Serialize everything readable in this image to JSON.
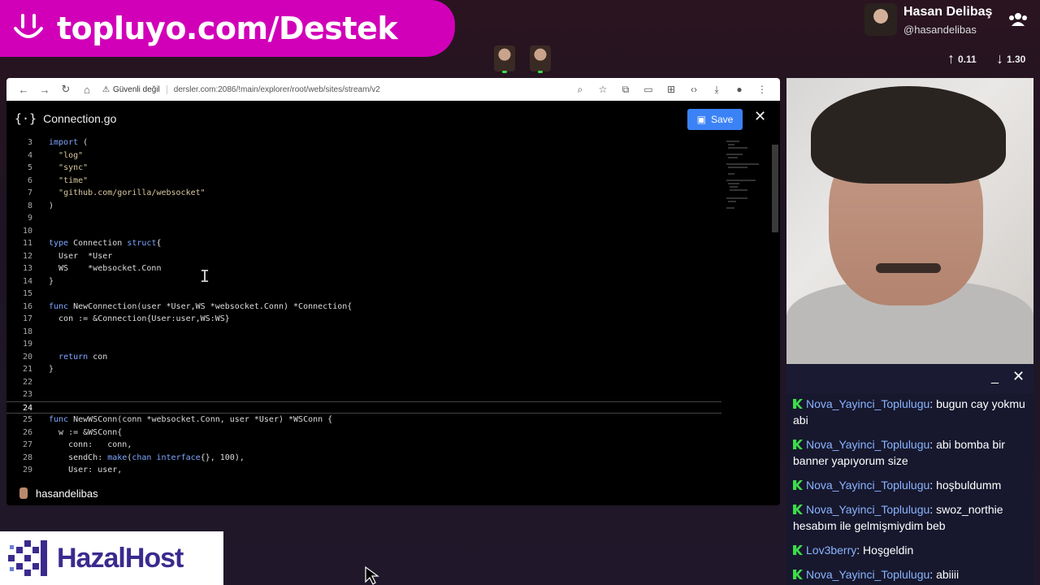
{
  "banner": {
    "text": "topluyo.com/Destek",
    "color": "#d100b8"
  },
  "profile": {
    "name": "Hasan Delibaş",
    "handle": "@hasandelibas",
    "upload": "0.11",
    "download": "1.30"
  },
  "browser": {
    "secure_label": "Güvenli değil",
    "url": "dersler.com:2086/!main/explorer/root/web/sites/stream/v2"
  },
  "editor": {
    "file_icon": "{·}",
    "filename": "Connection.go",
    "save_label": "Save",
    "current_line": "24",
    "lines": [
      {
        "n": "3",
        "t": "import ("
      },
      {
        "n": "4",
        "t": "  \"log\""
      },
      {
        "n": "5",
        "t": "  \"sync\""
      },
      {
        "n": "6",
        "t": "  \"time\""
      },
      {
        "n": "7",
        "t": "  \"github.com/gorilla/websocket\""
      },
      {
        "n": "8",
        "t": ")"
      },
      {
        "n": "9",
        "t": ""
      },
      {
        "n": "10",
        "t": ""
      },
      {
        "n": "11",
        "t": "type Connection struct{"
      },
      {
        "n": "12",
        "t": "  User  *User"
      },
      {
        "n": "13",
        "t": "  WS    *websocket.Conn"
      },
      {
        "n": "14",
        "t": "}"
      },
      {
        "n": "15",
        "t": ""
      },
      {
        "n": "16",
        "t": "func NewConnection(user *User,WS *websocket.Conn) *Connection{"
      },
      {
        "n": "17",
        "t": "  con := &Connection{User:user,WS:WS}"
      },
      {
        "n": "18",
        "t": ""
      },
      {
        "n": "19",
        "t": ""
      },
      {
        "n": "20",
        "t": "  return con"
      },
      {
        "n": "21",
        "t": "}"
      },
      {
        "n": "22",
        "t": ""
      },
      {
        "n": "23",
        "t": ""
      },
      {
        "n": "24",
        "t": ""
      },
      {
        "n": "25",
        "t": "func NewWSConn(conn *websocket.Conn, user *User) *WSConn {"
      },
      {
        "n": "26",
        "t": "  w := &WSConn{"
      },
      {
        "n": "27",
        "t": "    conn:   conn,"
      },
      {
        "n": "28",
        "t": "    sendCh: make(chan interface{}, 100),"
      },
      {
        "n": "29",
        "t": "    User: user,"
      }
    ]
  },
  "footer_user": "hasandelibas",
  "chat": {
    "messages": [
      {
        "user": "Nova_Yayinci_Toplulugu",
        "text": "bugun cay yokmu abi"
      },
      {
        "user": "Nova_Yayinci_Toplulugu",
        "text": "abi bomba bir banner yapıyorum size"
      },
      {
        "user": "Nova_Yayinci_Toplulugu",
        "text": "hoşbuldumm"
      },
      {
        "user": "Nova_Yayinci_Toplulugu",
        "text": "swoz_northie hesabım ile gelmişmiydim beb"
      },
      {
        "user": "Lov3berry",
        "text": "Hoşgeldin"
      },
      {
        "user": "Nova_Yayinci_Toplulugu",
        "text": "abiiii"
      }
    ]
  },
  "logo": {
    "text": "HazalHost"
  }
}
